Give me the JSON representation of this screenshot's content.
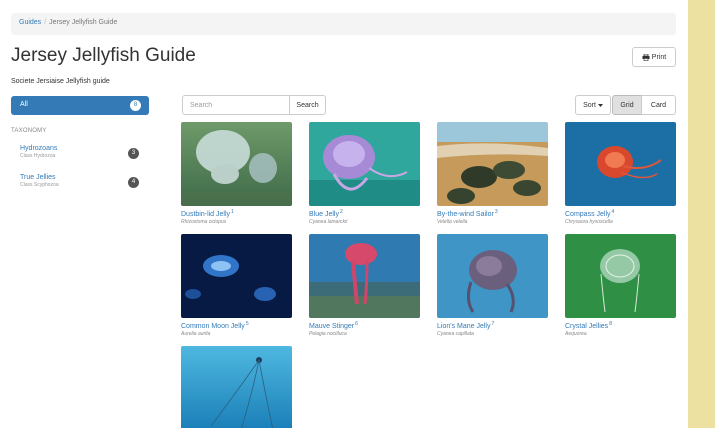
{
  "breadcrumb": {
    "home": "Guides",
    "separator": "/",
    "current": "Jersey Jellyfish Guide"
  },
  "page": {
    "title": "Jersey Jellyfish Guide",
    "subtitle": "Societe Jersiaise Jellyfish guide"
  },
  "toolbar": {
    "print_label": "Print",
    "print_icon": "printer-icon",
    "search_placeholder": "Search",
    "search_button": "Search",
    "sort_label": "Sort",
    "sort_icon": "caret-down-icon",
    "view_grid": "Grid",
    "view_card": "Card",
    "active_view": "Grid"
  },
  "sidebar": {
    "all": {
      "label": "All",
      "count": "8"
    },
    "taxonomy_heading": "TAXONOMY",
    "items": [
      {
        "name": "Hydrozoans",
        "class": "Class Hydrozoa",
        "count": "3"
      },
      {
        "name": "True Jellies",
        "class": "Class Scyphozoa",
        "count": "4"
      }
    ]
  },
  "colors": {
    "link": "#337ab7",
    "primary": "#337ab7",
    "badge": "#555555",
    "page_border": "#ece1a0"
  },
  "species": [
    {
      "name": "Dustbin-lid Jelly",
      "num": "1",
      "sci": "Rhizostoma octopus"
    },
    {
      "name": "Blue Jelly",
      "num": "2",
      "sci": "Cyanea lamarckii"
    },
    {
      "name": "By-the-wind Sailor",
      "num": "3",
      "sci": "Velella velella"
    },
    {
      "name": "Compass Jelly",
      "num": "4",
      "sci": "Chrysaora hysoscella"
    },
    {
      "name": "Common Moon Jelly",
      "num": "5",
      "sci": "Aurelia aurita"
    },
    {
      "name": "Mauve Stinger",
      "num": "6",
      "sci": "Pelagia noctiluca"
    },
    {
      "name": "Lion's Mane Jelly",
      "num": "7",
      "sci": "Cyanea capillata"
    },
    {
      "name": "Crystal Jellies",
      "num": "8",
      "sci": "Aequorea"
    },
    {
      "name": "",
      "num": "",
      "sci": ""
    }
  ]
}
